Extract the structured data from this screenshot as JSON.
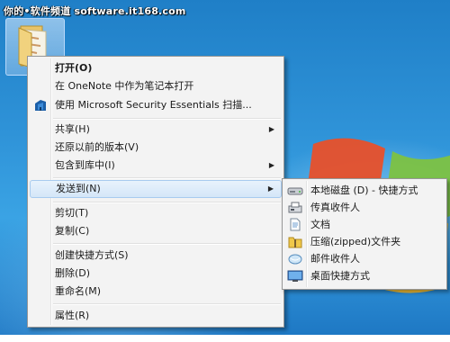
{
  "watermark": "你的•软件频道 software.it168.com",
  "context_menu": {
    "items": [
      {
        "label": "打开(O)"
      },
      {
        "label": "在 OneNote 中作为笔记本打开"
      },
      {
        "label": "使用 Microsoft Security Essentials 扫描..."
      },
      {
        "label": "共享(H)"
      },
      {
        "label": "还原以前的版本(V)"
      },
      {
        "label": "包含到库中(I)"
      },
      {
        "label": "发送到(N)"
      },
      {
        "label": "剪切(T)"
      },
      {
        "label": "复制(C)"
      },
      {
        "label": "创建快捷方式(S)"
      },
      {
        "label": "删除(D)"
      },
      {
        "label": "重命名(M)"
      },
      {
        "label": "属性(R)"
      }
    ]
  },
  "send_to_submenu": {
    "items": [
      {
        "label": "本地磁盘 (D) - 快捷方式",
        "icon": "drive-icon"
      },
      {
        "label": "传真收件人",
        "icon": "fax-icon"
      },
      {
        "label": "文档",
        "icon": "document-icon"
      },
      {
        "label": "压缩(zipped)文件夹",
        "icon": "zip-folder-icon"
      },
      {
        "label": "邮件收件人",
        "icon": "mail-icon"
      },
      {
        "label": "桌面快捷方式",
        "icon": "desktop-icon"
      }
    ]
  },
  "colors": {
    "desktop": "#2f93d8",
    "menu_bg": "#f3f3f3",
    "highlight_border": "#a8cbef"
  }
}
